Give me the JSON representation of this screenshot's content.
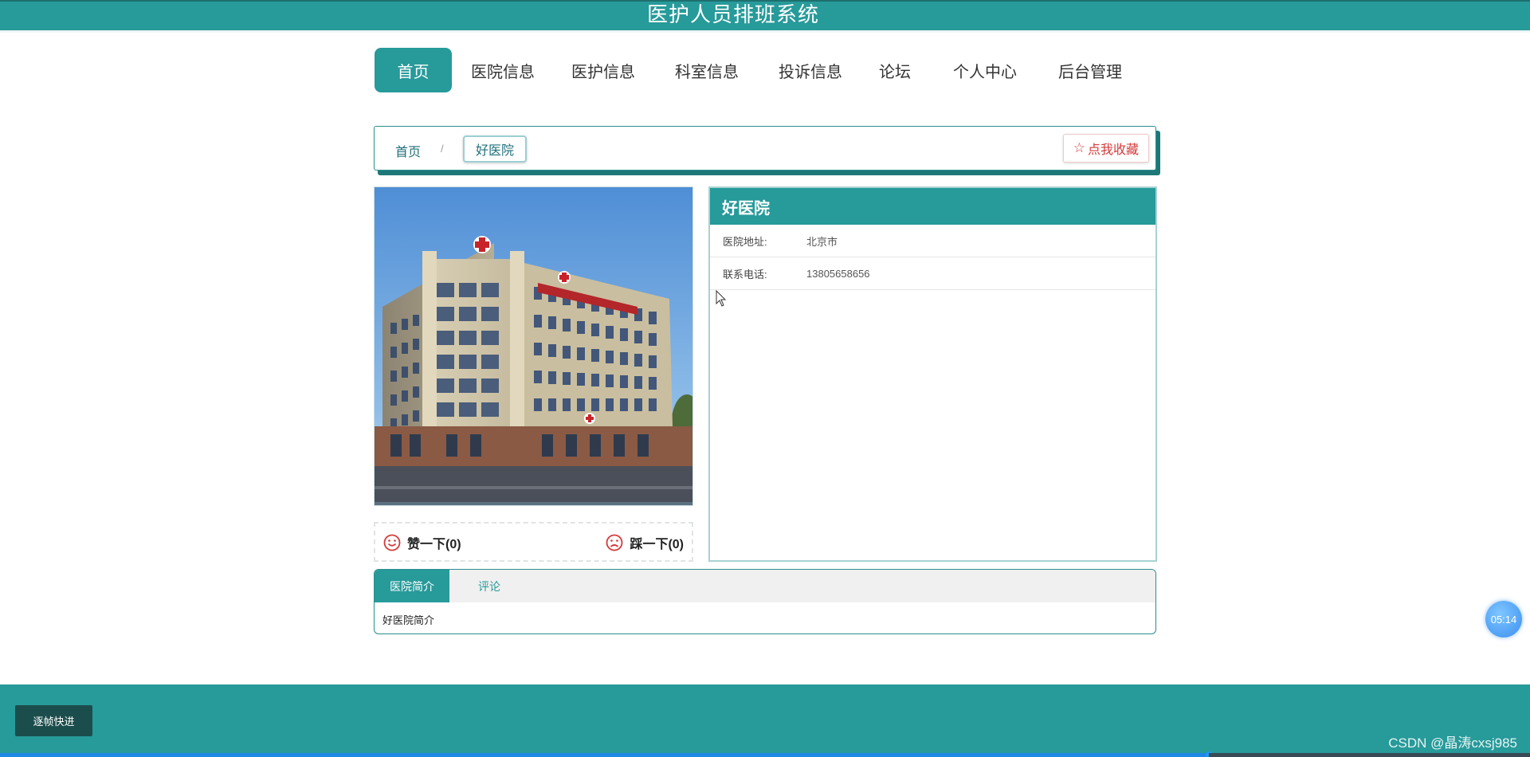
{
  "header": {
    "title": "医护人员排班系统"
  },
  "nav": {
    "items": [
      {
        "label": "首页",
        "active": true
      },
      {
        "label": "医院信息"
      },
      {
        "label": "医护信息"
      },
      {
        "label": "科室信息"
      },
      {
        "label": "投诉信息"
      },
      {
        "label": "论坛"
      },
      {
        "label": "个人中心"
      },
      {
        "label": "后台管理"
      }
    ]
  },
  "breadcrumb": {
    "home": "首页",
    "separator": "/",
    "current": "好医院"
  },
  "favorite_button": {
    "icon": "star-outline-icon",
    "label": "点我收藏"
  },
  "votes": {
    "like": {
      "icon": "smile-icon",
      "label": "赞一下(0)"
    },
    "dislike": {
      "icon": "frown-icon",
      "label": "踩一下(0)"
    }
  },
  "hospital": {
    "name": "好医院",
    "fields": [
      {
        "label": "医院地址:",
        "value": "北京市"
      },
      {
        "label": "联系电话:",
        "value": "13805658656"
      }
    ]
  },
  "tabs": {
    "items": [
      {
        "label": "医院简介",
        "active": true
      },
      {
        "label": "评论"
      }
    ],
    "content": "好医院简介"
  },
  "timer": {
    "text": "05:14"
  },
  "footer": {
    "step_button": "逐帧快进",
    "watermark": "CSDN @晶涛cxsj985"
  },
  "player_progress": 0.79,
  "colors": {
    "primary": "#279a9a",
    "accent_red": "#d43a3a",
    "dark_button": "#1c4d4d"
  }
}
